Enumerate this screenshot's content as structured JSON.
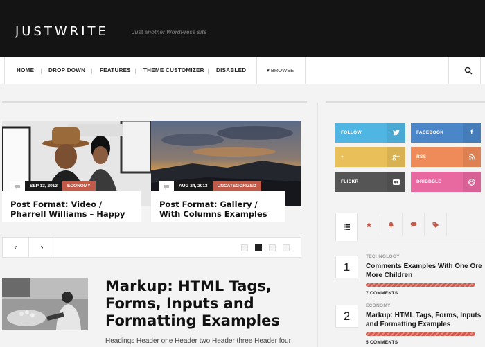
{
  "site": {
    "title": "JUSTWRITE",
    "description": "Just another WordPress site"
  },
  "nav": {
    "items": [
      "HOME",
      "DROP DOWN",
      "FEATURES",
      "THEME CUSTOMIZER",
      "DISABLED"
    ],
    "browse": "▾ BROWSE",
    "search_icon": "search-icon"
  },
  "slider": {
    "slides": [
      {
        "date": "SEP 13, 2013",
        "category": "ECONOMY",
        "title": "Post Format: Video / Pharrell Williams – Happy"
      },
      {
        "date": "AUG 24, 2013",
        "category": "UNCATEGORIZED",
        "title": "Post Format: Gallery / With Columns Examples"
      }
    ],
    "prev": "‹",
    "next": "›",
    "pager": {
      "count": 4,
      "active": 2
    }
  },
  "featured_post": {
    "title": "Markup: HTML Tags, Forms, Inputs and Formatting Examples",
    "excerpt": "Headings Header one Header two Header three Header four"
  },
  "social": [
    {
      "label": "FOLLOW",
      "icon": "twitter-icon",
      "glyph": "🐦",
      "color": "#4fb6e3"
    },
    {
      "label": "FACEBOOK",
      "icon": "facebook-icon",
      "glyph": "f",
      "color": "#4b86c9"
    },
    {
      "label": "+",
      "icon": "google-plus-icon",
      "glyph": "g+",
      "color": "#e8bf59"
    },
    {
      "label": "RSS",
      "icon": "rss-icon",
      "glyph": "◉",
      "color": "#ee8b59"
    },
    {
      "label": "FLICKR",
      "icon": "flickr-icon",
      "glyph": "●●",
      "color": "#555555"
    },
    {
      "label": "DRIBBBLE",
      "icon": "dribbble-icon",
      "glyph": "◍",
      "color": "#e868a0"
    }
  ],
  "widget": {
    "tabs": [
      "list-icon",
      "star-icon",
      "bell-icon",
      "comments-icon",
      "tags-icon"
    ],
    "posts": [
      {
        "num": "1",
        "category": "TECHNOLOGY",
        "title": "Comments Examples With One Ore More Children",
        "comments": "7 COMMENTS"
      },
      {
        "num": "2",
        "category": "ECONOMY",
        "title": "Markup: HTML Tags, Forms, Inputs and Formatting Examples",
        "comments": "5 COMMENTS"
      }
    ]
  },
  "colors": {
    "accent": "#c25a4a",
    "topbar": "#141414"
  }
}
